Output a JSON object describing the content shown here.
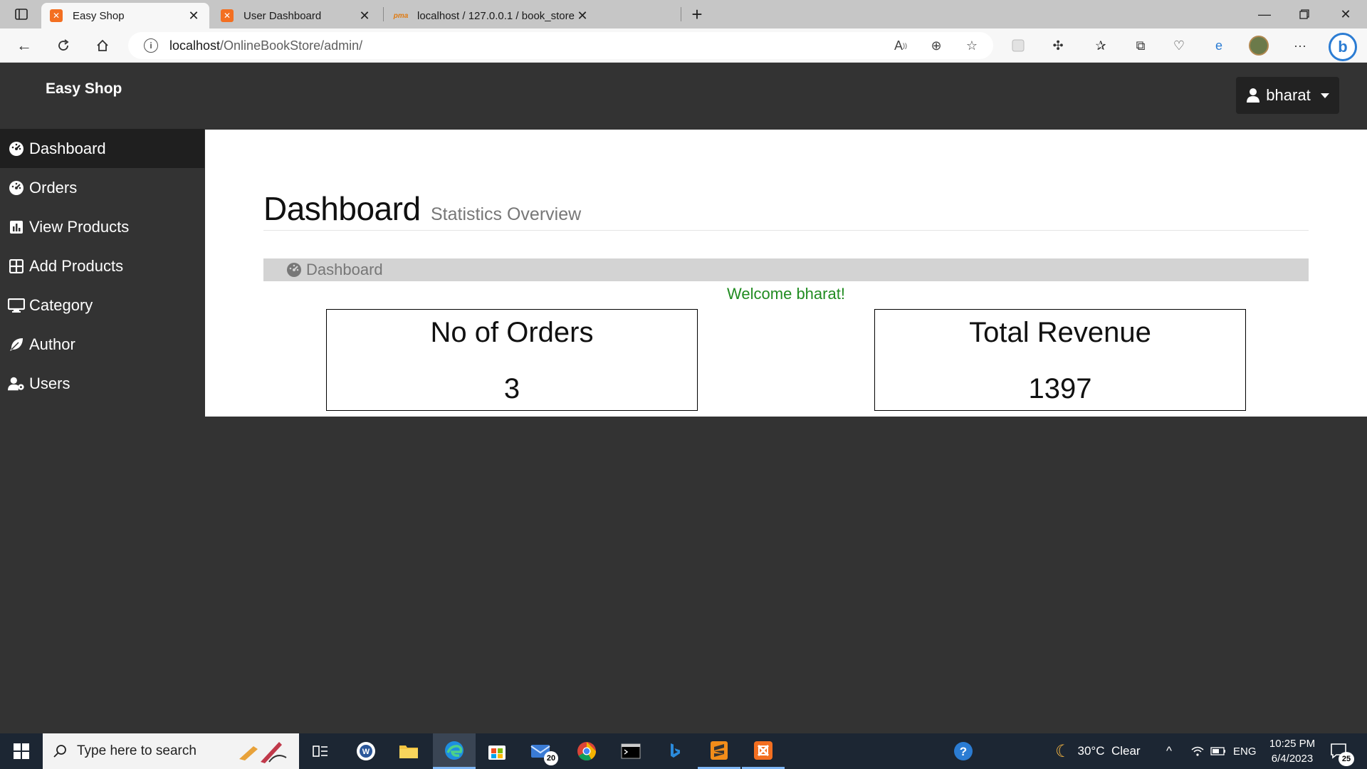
{
  "browser": {
    "tabs": [
      {
        "title": "Easy Shop",
        "favicon": "xampp-icon",
        "active": true
      },
      {
        "title": "User Dashboard",
        "favicon": "xampp-icon",
        "active": false
      },
      {
        "title": "localhost / 127.0.0.1 / book_store",
        "favicon": "phpmyadmin-icon",
        "active": false
      }
    ],
    "url_host": "localhost",
    "url_path": "/OnlineBookStore/admin/"
  },
  "site": {
    "brand": "Easy Shop",
    "user": "bharat"
  },
  "sidebar": {
    "items": [
      {
        "label": "Dashboard",
        "icon": "dashboard-icon"
      },
      {
        "label": "Orders",
        "icon": "dashboard-icon"
      },
      {
        "label": "View Products",
        "icon": "bar-chart-icon"
      },
      {
        "label": "Add Products",
        "icon": "grid-icon"
      },
      {
        "label": "Category",
        "icon": "desktop-icon"
      },
      {
        "label": "Author",
        "icon": "feather-icon"
      },
      {
        "label": "Users",
        "icon": "users-cog-icon"
      }
    ]
  },
  "main": {
    "title": "Dashboard",
    "subtitle": "Statistics Overview",
    "breadcrumb": "Dashboard",
    "welcome": "Welcome bharat!",
    "stats": [
      {
        "label": "No of Orders",
        "value": "3"
      },
      {
        "label": "Total Revenue",
        "value": "1397"
      }
    ]
  },
  "taskbar": {
    "search_placeholder": "Type here to search",
    "mail_badge": "20",
    "weather": "30°C  Clear",
    "language": "ENG",
    "time": "10:25 PM",
    "date": "6/4/2023",
    "notifications": "25"
  },
  "colors": {
    "page_bg": "#333333",
    "active_sidebar": "#1f1f1f",
    "welcome_text": "#218c21",
    "breadcrumb_bg": "#d3d3d3"
  }
}
